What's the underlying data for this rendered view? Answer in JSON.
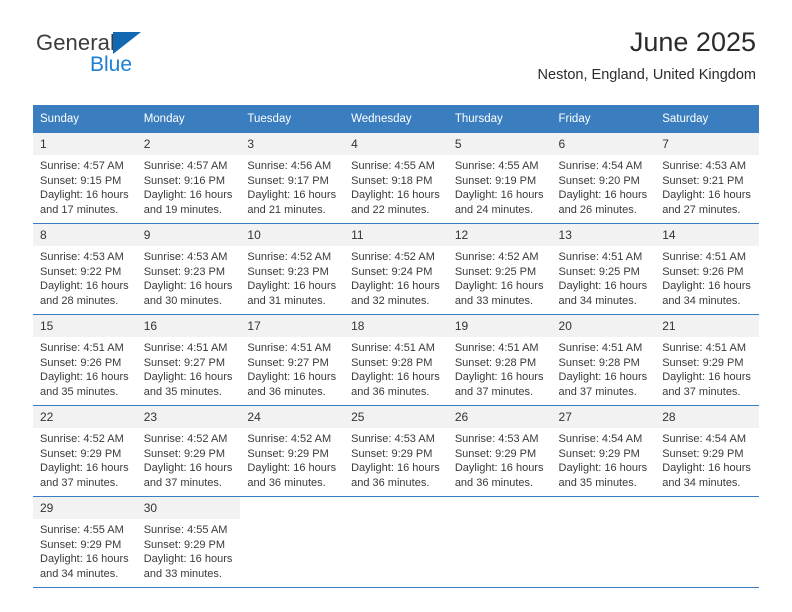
{
  "brand": {
    "name_part1": "General",
    "name_part2": "Blue",
    "logo_icon": "triangle-icon"
  },
  "header": {
    "title": "June 2025",
    "subtitle": "Neston, England, United Kingdom"
  },
  "calendar": {
    "weekday_headers": [
      "Sunday",
      "Monday",
      "Tuesday",
      "Wednesday",
      "Thursday",
      "Friday",
      "Saturday"
    ],
    "header_bg_color": "#3a7ebf",
    "daynum_bg_color": "#f2f2f2",
    "weeks": [
      [
        {
          "day": "1",
          "sunrise": "Sunrise: 4:57 AM",
          "sunset": "Sunset: 9:15 PM",
          "daylight_line1": "Daylight: 16 hours",
          "daylight_line2": "and 17 minutes."
        },
        {
          "day": "2",
          "sunrise": "Sunrise: 4:57 AM",
          "sunset": "Sunset: 9:16 PM",
          "daylight_line1": "Daylight: 16 hours",
          "daylight_line2": "and 19 minutes."
        },
        {
          "day": "3",
          "sunrise": "Sunrise: 4:56 AM",
          "sunset": "Sunset: 9:17 PM",
          "daylight_line1": "Daylight: 16 hours",
          "daylight_line2": "and 21 minutes."
        },
        {
          "day": "4",
          "sunrise": "Sunrise: 4:55 AM",
          "sunset": "Sunset: 9:18 PM",
          "daylight_line1": "Daylight: 16 hours",
          "daylight_line2": "and 22 minutes."
        },
        {
          "day": "5",
          "sunrise": "Sunrise: 4:55 AM",
          "sunset": "Sunset: 9:19 PM",
          "daylight_line1": "Daylight: 16 hours",
          "daylight_line2": "and 24 minutes."
        },
        {
          "day": "6",
          "sunrise": "Sunrise: 4:54 AM",
          "sunset": "Sunset: 9:20 PM",
          "daylight_line1": "Daylight: 16 hours",
          "daylight_line2": "and 26 minutes."
        },
        {
          "day": "7",
          "sunrise": "Sunrise: 4:53 AM",
          "sunset": "Sunset: 9:21 PM",
          "daylight_line1": "Daylight: 16 hours",
          "daylight_line2": "and 27 minutes."
        }
      ],
      [
        {
          "day": "8",
          "sunrise": "Sunrise: 4:53 AM",
          "sunset": "Sunset: 9:22 PM",
          "daylight_line1": "Daylight: 16 hours",
          "daylight_line2": "and 28 minutes."
        },
        {
          "day": "9",
          "sunrise": "Sunrise: 4:53 AM",
          "sunset": "Sunset: 9:23 PM",
          "daylight_line1": "Daylight: 16 hours",
          "daylight_line2": "and 30 minutes."
        },
        {
          "day": "10",
          "sunrise": "Sunrise: 4:52 AM",
          "sunset": "Sunset: 9:23 PM",
          "daylight_line1": "Daylight: 16 hours",
          "daylight_line2": "and 31 minutes."
        },
        {
          "day": "11",
          "sunrise": "Sunrise: 4:52 AM",
          "sunset": "Sunset: 9:24 PM",
          "daylight_line1": "Daylight: 16 hours",
          "daylight_line2": "and 32 minutes."
        },
        {
          "day": "12",
          "sunrise": "Sunrise: 4:52 AM",
          "sunset": "Sunset: 9:25 PM",
          "daylight_line1": "Daylight: 16 hours",
          "daylight_line2": "and 33 minutes."
        },
        {
          "day": "13",
          "sunrise": "Sunrise: 4:51 AM",
          "sunset": "Sunset: 9:25 PM",
          "daylight_line1": "Daylight: 16 hours",
          "daylight_line2": "and 34 minutes."
        },
        {
          "day": "14",
          "sunrise": "Sunrise: 4:51 AM",
          "sunset": "Sunset: 9:26 PM",
          "daylight_line1": "Daylight: 16 hours",
          "daylight_line2": "and 34 minutes."
        }
      ],
      [
        {
          "day": "15",
          "sunrise": "Sunrise: 4:51 AM",
          "sunset": "Sunset: 9:26 PM",
          "daylight_line1": "Daylight: 16 hours",
          "daylight_line2": "and 35 minutes."
        },
        {
          "day": "16",
          "sunrise": "Sunrise: 4:51 AM",
          "sunset": "Sunset: 9:27 PM",
          "daylight_line1": "Daylight: 16 hours",
          "daylight_line2": "and 35 minutes."
        },
        {
          "day": "17",
          "sunrise": "Sunrise: 4:51 AM",
          "sunset": "Sunset: 9:27 PM",
          "daylight_line1": "Daylight: 16 hours",
          "daylight_line2": "and 36 minutes."
        },
        {
          "day": "18",
          "sunrise": "Sunrise: 4:51 AM",
          "sunset": "Sunset: 9:28 PM",
          "daylight_line1": "Daylight: 16 hours",
          "daylight_line2": "and 36 minutes."
        },
        {
          "day": "19",
          "sunrise": "Sunrise: 4:51 AM",
          "sunset": "Sunset: 9:28 PM",
          "daylight_line1": "Daylight: 16 hours",
          "daylight_line2": "and 37 minutes."
        },
        {
          "day": "20",
          "sunrise": "Sunrise: 4:51 AM",
          "sunset": "Sunset: 9:28 PM",
          "daylight_line1": "Daylight: 16 hours",
          "daylight_line2": "and 37 minutes."
        },
        {
          "day": "21",
          "sunrise": "Sunrise: 4:51 AM",
          "sunset": "Sunset: 9:29 PM",
          "daylight_line1": "Daylight: 16 hours",
          "daylight_line2": "and 37 minutes."
        }
      ],
      [
        {
          "day": "22",
          "sunrise": "Sunrise: 4:52 AM",
          "sunset": "Sunset: 9:29 PM",
          "daylight_line1": "Daylight: 16 hours",
          "daylight_line2": "and 37 minutes."
        },
        {
          "day": "23",
          "sunrise": "Sunrise: 4:52 AM",
          "sunset": "Sunset: 9:29 PM",
          "daylight_line1": "Daylight: 16 hours",
          "daylight_line2": "and 37 minutes."
        },
        {
          "day": "24",
          "sunrise": "Sunrise: 4:52 AM",
          "sunset": "Sunset: 9:29 PM",
          "daylight_line1": "Daylight: 16 hours",
          "daylight_line2": "and 36 minutes."
        },
        {
          "day": "25",
          "sunrise": "Sunrise: 4:53 AM",
          "sunset": "Sunset: 9:29 PM",
          "daylight_line1": "Daylight: 16 hours",
          "daylight_line2": "and 36 minutes."
        },
        {
          "day": "26",
          "sunrise": "Sunrise: 4:53 AM",
          "sunset": "Sunset: 9:29 PM",
          "daylight_line1": "Daylight: 16 hours",
          "daylight_line2": "and 36 minutes."
        },
        {
          "day": "27",
          "sunrise": "Sunrise: 4:54 AM",
          "sunset": "Sunset: 9:29 PM",
          "daylight_line1": "Daylight: 16 hours",
          "daylight_line2": "and 35 minutes."
        },
        {
          "day": "28",
          "sunrise": "Sunrise: 4:54 AM",
          "sunset": "Sunset: 9:29 PM",
          "daylight_line1": "Daylight: 16 hours",
          "daylight_line2": "and 34 minutes."
        }
      ],
      [
        {
          "day": "29",
          "sunrise": "Sunrise: 4:55 AM",
          "sunset": "Sunset: 9:29 PM",
          "daylight_line1": "Daylight: 16 hours",
          "daylight_line2": "and 34 minutes."
        },
        {
          "day": "30",
          "sunrise": "Sunrise: 4:55 AM",
          "sunset": "Sunset: 9:29 PM",
          "daylight_line1": "Daylight: 16 hours",
          "daylight_line2": "and 33 minutes."
        },
        {
          "day": "",
          "sunrise": "",
          "sunset": "",
          "daylight_line1": "",
          "daylight_line2": ""
        },
        {
          "day": "",
          "sunrise": "",
          "sunset": "",
          "daylight_line1": "",
          "daylight_line2": ""
        },
        {
          "day": "",
          "sunrise": "",
          "sunset": "",
          "daylight_line1": "",
          "daylight_line2": ""
        },
        {
          "day": "",
          "sunrise": "",
          "sunset": "",
          "daylight_line1": "",
          "daylight_line2": ""
        },
        {
          "day": "",
          "sunrise": "",
          "sunset": "",
          "daylight_line1": "",
          "daylight_line2": ""
        }
      ]
    ]
  }
}
